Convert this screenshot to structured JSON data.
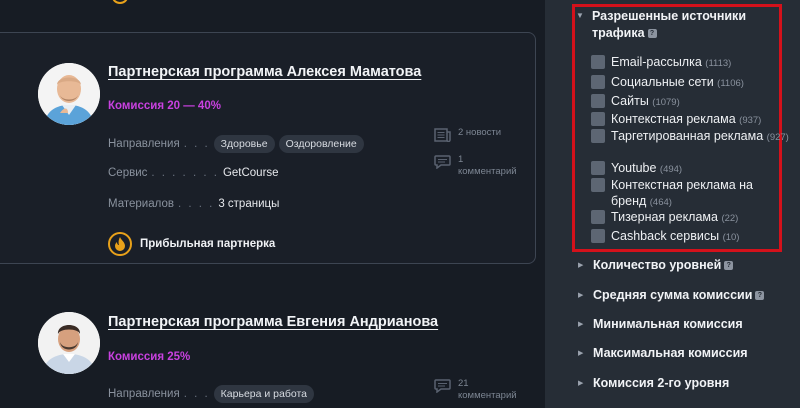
{
  "cards": [
    {
      "title": "Партнерская программа Алексея Маматова",
      "commission": "Комиссия 20 — 40%",
      "directions_label": "Направления",
      "directions_dots": ". . .",
      "tags": [
        "Здоровье",
        "Оздоровление"
      ],
      "service_label": "Сервис",
      "service_dots": ". . . . . . .",
      "service_value": "GetCourse",
      "materials_label": "Материалов",
      "materials_dots": ". . . .",
      "materials_value": "3 страницы",
      "news": "2 новости",
      "comments": "1 комментарий",
      "badge": "Прибыльная партнерка"
    },
    {
      "title": "Партнерская программа Евгения Андрианова",
      "commission": "Комиссия 25%",
      "directions_label": "Направления",
      "directions_dots": ". . .",
      "tags": [
        "Карьера и работа"
      ],
      "comments": "21 комментарий"
    }
  ],
  "sidebar": {
    "filter": {
      "title": "Разрешенные источники трафика",
      "help": "?",
      "items": [
        {
          "label": "Email-рассылка",
          "count": "(1113)"
        },
        {
          "label": "Социальные сети",
          "count": "(1106)"
        },
        {
          "label": "Сайты",
          "count": "(1079)"
        },
        {
          "label": "Контекстная реклама",
          "count": "(937)"
        },
        {
          "label": "Таргетированная реклама",
          "count": "(927)"
        },
        {
          "label": "Youtube",
          "count": "(494)"
        },
        {
          "label": "Контекстная реклама на бренд",
          "count": "(464)"
        },
        {
          "label": "Тизерная реклама",
          "count": "(22)"
        },
        {
          "label": "Cashback сервисы",
          "count": "(10)"
        }
      ]
    },
    "accordion": [
      {
        "label": "Количество уровней",
        "help": "?"
      },
      {
        "label": "Средняя сумма комиссии",
        "help": "?"
      },
      {
        "label": "Минимальная комиссия"
      },
      {
        "label": "Максимальная комиссия"
      },
      {
        "label": "Комиссия 2-го уровня"
      }
    ]
  },
  "colors": {
    "accent_purple": "#c941e0",
    "badge_orange": "#e8a11a",
    "highlight_red": "#d4111b"
  },
  "icons": [
    "fire-icon",
    "news-icon",
    "comment-icon",
    "checkbox",
    "question-icon",
    "triangle-right-icon",
    "triangle-down-icon"
  ]
}
